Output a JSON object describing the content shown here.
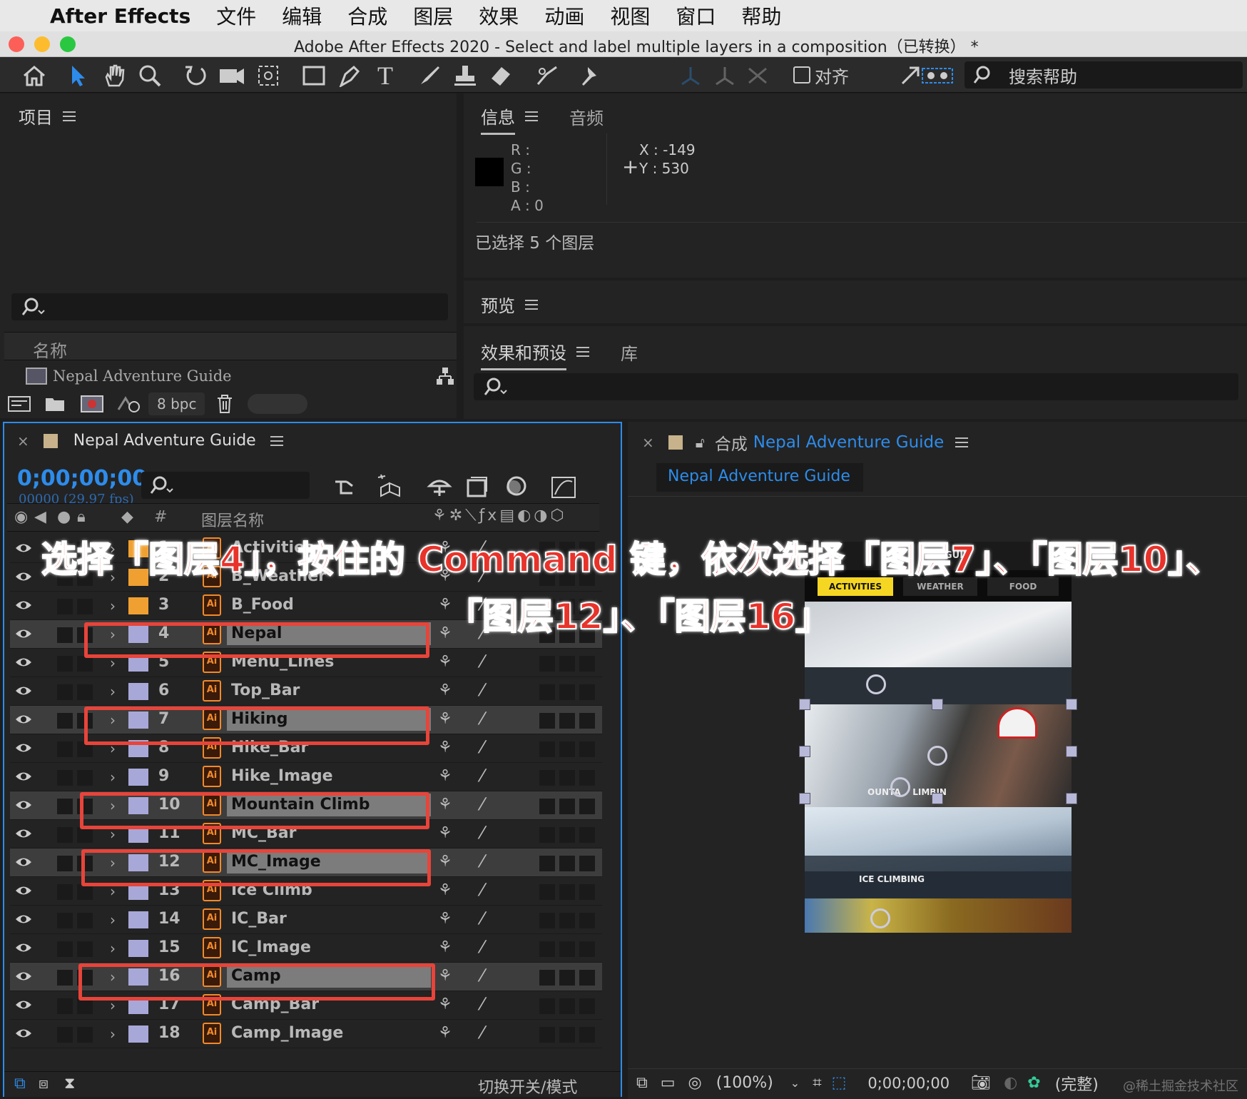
{
  "menubar": {
    "app": "After Effects",
    "items": [
      "文件",
      "编辑",
      "合成",
      "图层",
      "效果",
      "动画",
      "视图",
      "窗口",
      "帮助"
    ]
  },
  "window": {
    "title": "Adobe After Effects 2020 - Select and label multiple layers in a composition（已转换） *"
  },
  "toolbar": {
    "align_label": "对齐",
    "help_search_placeholder": "搜索帮助"
  },
  "project_panel": {
    "tab": "项目",
    "column_name": "名称",
    "item": "Nepal Adventure Guide",
    "bpc": "8 bpc"
  },
  "info_panel": {
    "tabs": [
      "信息",
      "音频"
    ],
    "r_label": "R :",
    "g_label": "G :",
    "b_label": "B :",
    "a_label": "A :",
    "a_value": "0",
    "x_label": "X : -149",
    "y_label": "Y :  530",
    "selection_text": "已选择 5 个图层",
    "swatch_color": "#000000"
  },
  "preview_panel": {
    "tab": "预览"
  },
  "effects_panel": {
    "tabs": [
      "效果和预设",
      "库"
    ]
  },
  "timeline": {
    "comp_name": "Nepal Adventure Guide",
    "timecode": "0;00;00;00",
    "fps": "00000 (29.97 fps)",
    "header_num": "#",
    "header_name": "图层名称",
    "footer_label": "切换开关/模式",
    "layers": [
      {
        "num": "1",
        "name": "Activities",
        "selected": false,
        "color": "#f0a030"
      },
      {
        "num": "2",
        "name": "B_Weather",
        "selected": false,
        "color": "#f0a030"
      },
      {
        "num": "3",
        "name": "B_Food",
        "selected": false,
        "color": "#f0a030"
      },
      {
        "num": "4",
        "name": "Nepal",
        "selected": true,
        "color": "#a8a8d8"
      },
      {
        "num": "5",
        "name": "Menu_Lines",
        "selected": false,
        "color": "#a8a8d8"
      },
      {
        "num": "6",
        "name": "Top_Bar",
        "selected": false,
        "color": "#a8a8d8"
      },
      {
        "num": "7",
        "name": "Hiking",
        "selected": true,
        "color": "#a8a8d8"
      },
      {
        "num": "8",
        "name": "Hike_Bar",
        "selected": false,
        "color": "#a8a8d8"
      },
      {
        "num": "9",
        "name": "Hike_Image",
        "selected": false,
        "color": "#a8a8d8"
      },
      {
        "num": "10",
        "name": "Mountain Climb",
        "selected": true,
        "color": "#a8a8d8"
      },
      {
        "num": "11",
        "name": "MC_Bar",
        "selected": false,
        "color": "#a8a8d8"
      },
      {
        "num": "12",
        "name": "MC_Image",
        "selected": true,
        "color": "#a8a8d8"
      },
      {
        "num": "13",
        "name": "Ice Climb",
        "selected": false,
        "color": "#a8a8d8"
      },
      {
        "num": "14",
        "name": "IC_Bar",
        "selected": false,
        "color": "#a8a8d8"
      },
      {
        "num": "15",
        "name": "IC_Image",
        "selected": false,
        "color": "#a8a8d8"
      },
      {
        "num": "16",
        "name": "Camp",
        "selected": true,
        "color": "#a8a8d8"
      },
      {
        "num": "17",
        "name": "Camp_Bar",
        "selected": false,
        "color": "#a8a8d8"
      },
      {
        "num": "18",
        "name": "Camp_Image",
        "selected": false,
        "color": "#a8a8d8"
      }
    ]
  },
  "composition_panel": {
    "tab_prefix": "合成",
    "tab_name": "Nepal Adventure Guide",
    "subtab": "Nepal Adventure Guide",
    "zoom": "(100%)",
    "timecode": "0;00;00;00",
    "quality": "(完整)",
    "preview": {
      "guide_text": "GUID",
      "nav": [
        "ACTIVITIES",
        "WEATHER",
        "FOOD"
      ],
      "labels": {
        "mountain": "OUNTA    LIMBIN",
        "ice": "ICE CLIMBING"
      }
    }
  },
  "overlay": {
    "line1": "选择「图层4」，按住的 Command 键，依次选择「图层7」、「图层10」、",
    "line2": "「图层12」、「图层16」",
    "watermark": "@稀土掘金技术社区"
  },
  "colors": {
    "accent": "#2d8ceb",
    "highlight": "#e8443a",
    "timecode": "#2d8ceb"
  }
}
